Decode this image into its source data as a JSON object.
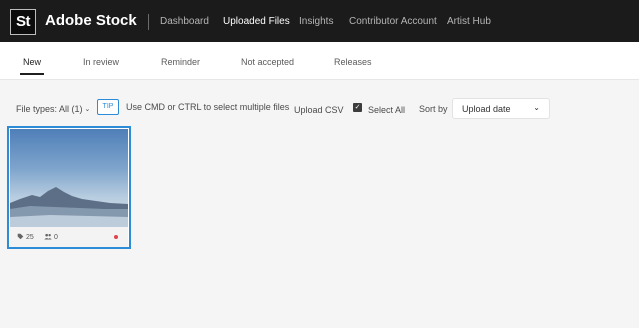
{
  "header": {
    "logo_badge": "St",
    "brand": "Adobe Stock",
    "nav": [
      {
        "label": "Dashboard",
        "active": false
      },
      {
        "label": "Uploaded Files",
        "active": true
      },
      {
        "label": "Insights",
        "active": false
      },
      {
        "label": "Contributor Account",
        "active": false
      },
      {
        "label": "Artist Hub",
        "active": false
      }
    ]
  },
  "tabs": [
    {
      "label": "New",
      "active": true
    },
    {
      "label": "In review",
      "active": false
    },
    {
      "label": "Reminder",
      "active": false
    },
    {
      "label": "Not accepted",
      "active": false
    },
    {
      "label": "Releases",
      "active": false
    }
  ],
  "toolbar": {
    "file_types": "File types: All (1)",
    "tip_badge": "TIP",
    "tip_text": "Use CMD or CTRL to select multiple files",
    "upload_csv": "Upload CSV",
    "select_all": "Select All",
    "select_all_checked": true,
    "sort_label": "Sort by",
    "sort_value": "Upload date"
  },
  "files": [
    {
      "keywords_count": "25",
      "people_count": "0",
      "status_color": "#e0434b",
      "selected": true,
      "thumbnail": "mountain-landscape-image"
    }
  ],
  "colors": {
    "accent": "#2c8cd8",
    "header_bg": "#1b1b1b"
  }
}
